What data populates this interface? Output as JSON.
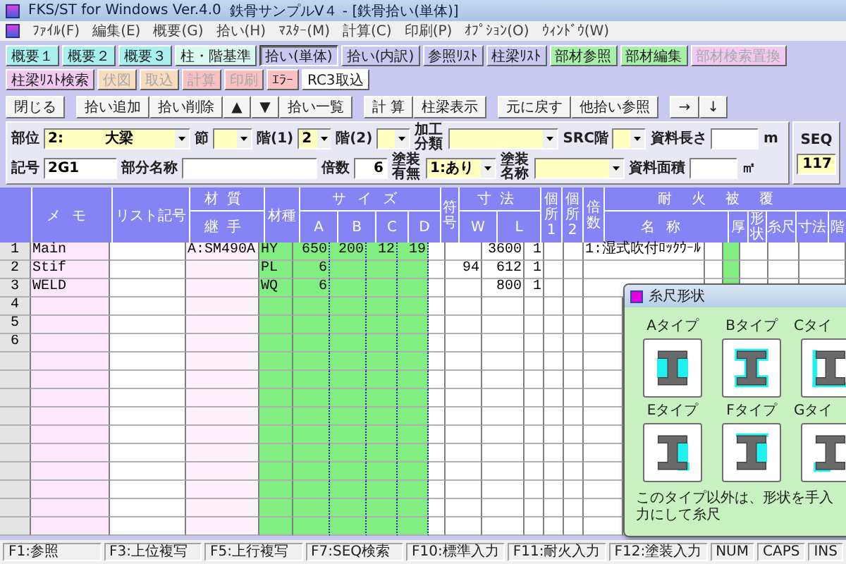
{
  "window": {
    "title": "FKS/ST for Windows Ver.4.0",
    "document": "鉄骨サンプルV４ - [鉄骨拾い(単体)]"
  },
  "menu": [
    "ﾌｧｲﾙ(F)",
    "編集(E)",
    "概要(G)",
    "拾い(H)",
    "ﾏｽﾀｰ(M)",
    "計算(C)",
    "印刷(P)",
    "ｵﾌﾟｼｮﾝ(O)",
    "ｳｨﾝﾄﾞｳ(W)"
  ],
  "toolbar": [
    {
      "label": "概要１",
      "color": "#a8f0f0",
      "selected": false,
      "disabled": false
    },
    {
      "label": "概要２",
      "color": "#a8f0f0",
      "selected": false,
      "disabled": false
    },
    {
      "label": "概要３",
      "color": "#a8f0f0",
      "selected": false,
      "disabled": false
    },
    {
      "label": "柱・階基準",
      "color": "#d8f8f0",
      "selected": false,
      "disabled": false
    },
    {
      "label": "拾い(単体)",
      "color": "#c8c8f0",
      "selected": true,
      "disabled": false
    },
    {
      "label": "拾い(内訳)",
      "color": "#c8c8f0",
      "selected": false,
      "disabled": false
    },
    {
      "label": "参照ﾘｽﾄ",
      "color": "#c8c8f0",
      "selected": false,
      "disabled": false
    },
    {
      "label": "柱梁ﾘｽﾄ",
      "color": "#c8c8f0",
      "selected": false,
      "disabled": false
    },
    {
      "label": "部材参照",
      "color": "#a8f0a8",
      "selected": false,
      "disabled": false
    },
    {
      "label": "部材編集",
      "color": "#a8f0a8",
      "selected": false,
      "disabled": false
    },
    {
      "label": "部材検索置換",
      "color": "#f0c8f0",
      "selected": false,
      "disabled": true
    },
    {
      "label": "柱梁ﾘｽﾄ検索",
      "color": "#f0c8f0",
      "selected": false,
      "disabled": false
    },
    {
      "label": "伏図",
      "color": "#f8dcc0",
      "selected": false,
      "disabled": true
    },
    {
      "label": "取込",
      "color": "#f8dcc0",
      "selected": false,
      "disabled": true
    },
    {
      "label": "計算",
      "color": "#f8c0c0",
      "selected": false,
      "disabled": true
    },
    {
      "label": "印刷",
      "color": "#f8c0c0",
      "selected": false,
      "disabled": true
    },
    {
      "label": "ｴﾗｰ",
      "color": "#f8c0c0",
      "selected": false,
      "disabled": false
    },
    {
      "label": "RC3取込",
      "color": "#ffffff",
      "selected": false,
      "disabled": false
    }
  ],
  "action_groups": [
    [
      "閉じる"
    ],
    [
      "拾い追加",
      "拾い削除",
      "▲",
      "▼",
      "拾い一覧"
    ],
    [
      "計 算",
      "柱梁表示"
    ],
    [
      "元に戻す",
      "他拾い参照"
    ],
    [
      "→",
      "↓"
    ]
  ],
  "form": {
    "part": {
      "label": "部位",
      "value": "2:",
      "text": "大梁"
    },
    "section": {
      "label": "節"
    },
    "floor1": {
      "label": "階(1)",
      "value": "2"
    },
    "floor2": {
      "label": "階(2)"
    },
    "processing": {
      "label": "加工分類"
    },
    "src_floor": {
      "label": "SRC階"
    },
    "length": {
      "label": "資料長さ",
      "unit": "m"
    },
    "mark": {
      "label": "記号",
      "value": "2G1"
    },
    "part_name": {
      "label": "部分名称"
    },
    "multiple": {
      "label": "倍数",
      "value": "6"
    },
    "painting": {
      "label": "塗装有無",
      "value": "1:あり"
    },
    "paint_name": {
      "label": "塗装名称"
    },
    "area": {
      "label": "資料面積",
      "unit": "㎡"
    },
    "seq": {
      "label": "SEQ",
      "value": "117"
    }
  },
  "table": {
    "headers": {
      "memo": "メモ",
      "list_mark": "リスト記号",
      "material": "材質",
      "joint": "継手",
      "grade": "材種",
      "size": "サイズ",
      "a": "A",
      "b": "B",
      "c": "C",
      "d": "D",
      "code": "符号",
      "dimension": "寸法",
      "w": "W",
      "l": "L",
      "place1": "個所1",
      "place2": "個所2",
      "multiple": "倍数",
      "fireproof": "耐火被覆",
      "fp_name": "名称",
      "fp_thick": "厚",
      "fp_shape": "形状",
      "fp_girth": "糸尺",
      "fp_size": "寸法",
      "fp_floor": "階"
    },
    "rows": [
      {
        "no": "1",
        "memo": "Main",
        "material": "A:SM490A",
        "grade": "HY",
        "a": "650",
        "b": "200",
        "c": "12",
        "d": "19",
        "l": "3600",
        "place1": "1",
        "fp_name": "1:湿式吹付ﾛｯｸｳｰﾙ"
      },
      {
        "no": "2",
        "memo": "Stif",
        "grade": "PL",
        "a": "6",
        "w": "94",
        "l": "612",
        "place1": "1"
      },
      {
        "no": "3",
        "memo": "WELD",
        "grade": "WQ",
        "a": "6",
        "l": "800",
        "place1": "1"
      },
      {
        "no": "4"
      },
      {
        "no": "5"
      },
      {
        "no": "6"
      }
    ]
  },
  "popup": {
    "title": "糸尺形状",
    "types": [
      {
        "label": "Aタイプ",
        "kind": "a"
      },
      {
        "label": "Bタイプ",
        "kind": "b"
      },
      {
        "label": "Cタイ",
        "kind": "c"
      },
      {
        "label": "Eタイプ",
        "kind": "e"
      },
      {
        "label": "Fタイプ",
        "kind": "f"
      },
      {
        "label": "Gタイ",
        "kind": "g"
      }
    ],
    "note": "このタイプ以外は、形状を手入力にして糸尺"
  },
  "status_bar": [
    "F1:参照",
    "F3:上位複写",
    "F5:上行複写",
    "F7:SEQ検索",
    "F10:標準入力",
    "F11:耐火入力",
    "F12:塗装入力",
    "NUM",
    "CAPS",
    "INS"
  ]
}
